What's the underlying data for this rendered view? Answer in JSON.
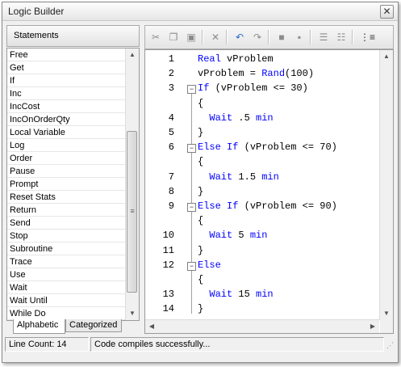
{
  "window": {
    "title": "Logic Builder",
    "close_label": "✕"
  },
  "statements": {
    "header": "Statements",
    "items": [
      "Free",
      "Get",
      "If",
      "Inc",
      "IncCost",
      "IncOnOrderQty",
      "Local Variable",
      "Log",
      "Order",
      "Pause",
      "Prompt",
      "Reset Stats",
      "Return",
      "Send",
      "Stop",
      "Subroutine",
      "Trace",
      "Use",
      "Wait",
      "Wait Until",
      "While Do"
    ],
    "tabs": [
      "Alphabetic",
      "Categorized"
    ],
    "active_tab": "Alphabetic"
  },
  "toolbar": {
    "icons": [
      "cut-icon",
      "copy-icon",
      "paste-icon",
      "delete-icon",
      "undo-icon",
      "redo-icon",
      "comment-icon",
      "uncomment-icon",
      "indent-icon",
      "outdent-icon",
      "line-numbers-icon"
    ]
  },
  "editor": {
    "lines": [
      {
        "num": "1",
        "fold": "",
        "parts": [
          {
            "t": "Real",
            "k": "kw"
          },
          {
            "t": " vProblem",
            "k": "pl"
          }
        ]
      },
      {
        "num": "2",
        "fold": "",
        "parts": [
          {
            "t": "vProblem = ",
            "k": "pl"
          },
          {
            "t": "Rand",
            "k": "kw"
          },
          {
            "t": "(100)",
            "k": "pl"
          }
        ]
      },
      {
        "num": "3",
        "fold": "−",
        "parts": [
          {
            "t": "If",
            "k": "kw"
          },
          {
            "t": " (vProblem <= 30)",
            "k": "pl"
          }
        ]
      },
      {
        "num": "",
        "fold": "",
        "parts": [
          {
            "t": "{",
            "k": "pl"
          }
        ]
      },
      {
        "num": "4",
        "fold": "",
        "parts": [
          {
            "t": "  ",
            "k": "pl"
          },
          {
            "t": "Wait",
            "k": "kw"
          },
          {
            "t": " .5 ",
            "k": "pl"
          },
          {
            "t": "min",
            "k": "kw"
          }
        ]
      },
      {
        "num": "5",
        "fold": "",
        "parts": [
          {
            "t": "}",
            "k": "pl"
          }
        ]
      },
      {
        "num": "6",
        "fold": "−",
        "parts": [
          {
            "t": "Else If",
            "k": "kw"
          },
          {
            "t": " (vProblem <= 70)",
            "k": "pl"
          }
        ]
      },
      {
        "num": "",
        "fold": "",
        "parts": [
          {
            "t": "{",
            "k": "pl"
          }
        ]
      },
      {
        "num": "7",
        "fold": "",
        "parts": [
          {
            "t": "  ",
            "k": "pl"
          },
          {
            "t": "Wait",
            "k": "kw"
          },
          {
            "t": " 1.5 ",
            "k": "pl"
          },
          {
            "t": "min",
            "k": "kw"
          }
        ]
      },
      {
        "num": "8",
        "fold": "",
        "parts": [
          {
            "t": "}",
            "k": "pl"
          }
        ]
      },
      {
        "num": "9",
        "fold": "−",
        "parts": [
          {
            "t": "Else If",
            "k": "kw"
          },
          {
            "t": " (vProblem <= 90)",
            "k": "pl"
          }
        ]
      },
      {
        "num": "",
        "fold": "",
        "parts": [
          {
            "t": "{",
            "k": "pl"
          }
        ]
      },
      {
        "num": "10",
        "fold": "",
        "parts": [
          {
            "t": "  ",
            "k": "pl"
          },
          {
            "t": "Wait",
            "k": "kw"
          },
          {
            "t": " 5 ",
            "k": "pl"
          },
          {
            "t": "min",
            "k": "kw"
          }
        ]
      },
      {
        "num": "11",
        "fold": "",
        "parts": [
          {
            "t": "}",
            "k": "pl"
          }
        ]
      },
      {
        "num": "12",
        "fold": "−",
        "parts": [
          {
            "t": "Else",
            "k": "kw"
          }
        ]
      },
      {
        "num": "",
        "fold": "",
        "parts": [
          {
            "t": "{",
            "k": "pl"
          }
        ]
      },
      {
        "num": "13",
        "fold": "",
        "parts": [
          {
            "t": "  ",
            "k": "pl"
          },
          {
            "t": "Wait",
            "k": "kw"
          },
          {
            "t": " 15 ",
            "k": "pl"
          },
          {
            "t": "min",
            "k": "kw"
          }
        ]
      },
      {
        "num": "14",
        "fold": "",
        "parts": [
          {
            "t": "}",
            "k": "pl"
          }
        ]
      }
    ]
  },
  "status": {
    "line_count": "Line Count: 14",
    "message": "Code compiles successfully..."
  }
}
